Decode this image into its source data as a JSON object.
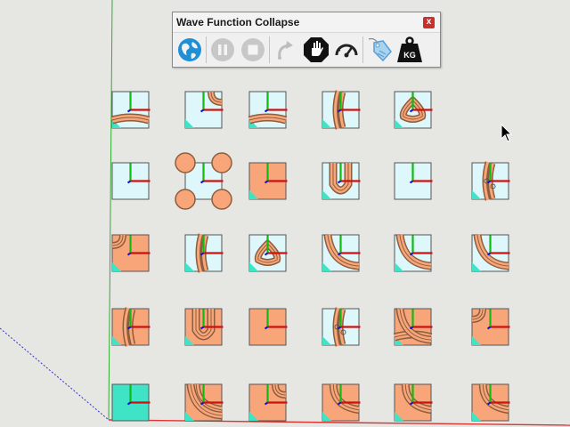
{
  "toolbar": {
    "title": "Wave Function Collapse",
    "close_label": "x",
    "logo_label": "KG",
    "buttons": [
      {
        "name": "globe-icon",
        "enabled": true
      },
      {
        "name": "pause-icon",
        "enabled": false
      },
      {
        "name": "stop-icon",
        "enabled": false
      },
      {
        "name": "redo-icon",
        "enabled": false
      },
      {
        "name": "hand-stop-icon",
        "enabled": true
      },
      {
        "name": "speedometer-icon",
        "enabled": true
      },
      {
        "name": "tag-icon",
        "enabled": true
      },
      {
        "name": "weight-kg-icon",
        "enabled": true
      }
    ]
  },
  "colors": {
    "background": "#e6e6e3",
    "water_light": "#ddf7fb",
    "water_teal": "#3fe3c6",
    "sand": "#f9a57a",
    "bank_brown": "#8b5e3c",
    "axis_red": "#cc1111",
    "axis_green": "#11bb11",
    "axis_blue": "#1111cc"
  },
  "tiles": [
    [
      "water_river_bottom",
      "water_road_corner_tr",
      "water_road_corner_bottom",
      "river_vertical_wide",
      "island_ring",
      "empty"
    ],
    [
      "water_plain",
      "water_four_corners",
      "sand_river_tr",
      "river_u_bend",
      "water_plain",
      "river_vertical_rocks"
    ],
    [
      "sand_corner_tl",
      "river_vertical_sand",
      "island_ring_sand",
      "water_arc_sand",
      "water_arc_double",
      "water_arc_sand"
    ],
    [
      "sand_river_left",
      "sand_u_bend",
      "sand_plain",
      "river_rocks",
      "sand_arc_bottom",
      "sand_corner_tl"
    ],
    [
      "water_teal_plain",
      "sand_arc_top",
      "sand_corner_tr",
      "sand_river_top",
      "sand_corner_top",
      "sand_corner_top_both"
    ]
  ]
}
